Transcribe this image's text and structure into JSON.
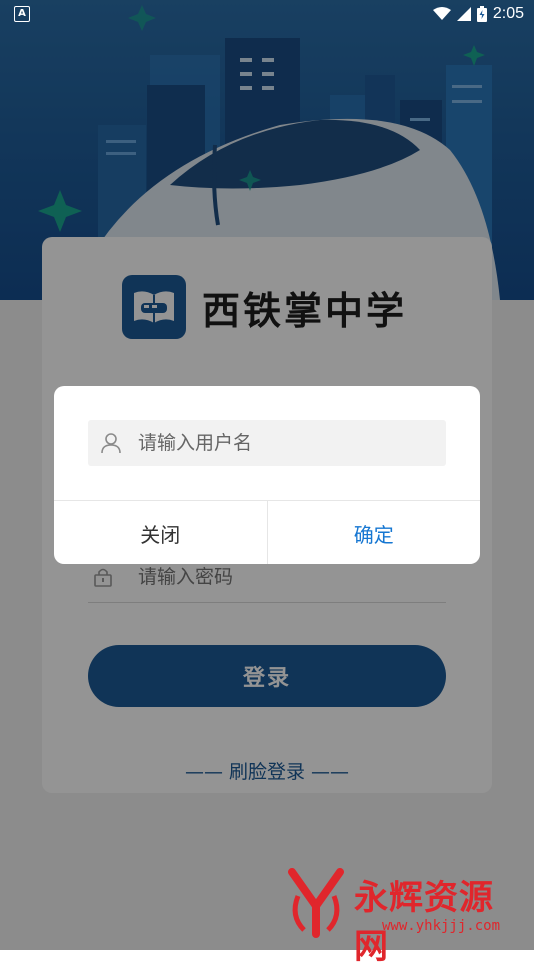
{
  "status_bar": {
    "notification_icon": "A",
    "time": "2:05",
    "icons": [
      "wifi-icon",
      "signal-icon",
      "battery-icon"
    ]
  },
  "app": {
    "title": "西铁掌中学",
    "logo": "book-train-logo-icon"
  },
  "login_form": {
    "password_placeholder": "请输入密码",
    "login_button": "登录",
    "face_login": "—— 刷脸登录 ——"
  },
  "dialog": {
    "username_placeholder": "请输入用户名",
    "close_button": "关闭",
    "confirm_button": "确定"
  },
  "watermark": {
    "name": "永辉资源网",
    "url": "www.yhkjjj.com"
  },
  "colors": {
    "primary": "#1d5a96",
    "confirm_text": "#1677d2",
    "watermark": "#e0262c"
  }
}
